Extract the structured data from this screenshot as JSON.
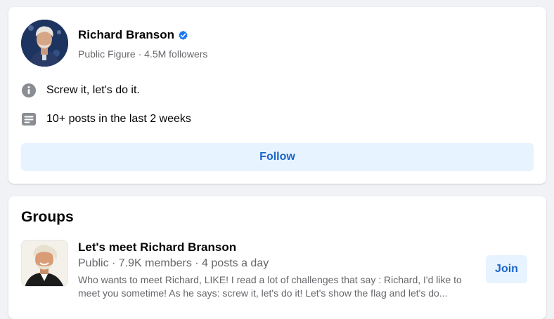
{
  "profile": {
    "name": "Richard Branson",
    "subtitle": "Public Figure · 4.5M followers",
    "verified": true,
    "info": [
      {
        "icon": "info-icon",
        "text": "Screw it, let's do it."
      },
      {
        "icon": "posts-icon",
        "text": "10+ posts in the last 2 weeks"
      }
    ],
    "follow_label": "Follow"
  },
  "groups": {
    "title": "Groups",
    "items": [
      {
        "name": "Let's meet Richard Branson",
        "meta": "Public · 7.9K members · 4 posts a day",
        "description": "Who wants to meet Richard, LIKE! I read a lot of challenges that say : Richard, I'd like to meet you sometime! As he says: screw it, let's do it! Let's show the flag and let's do...",
        "join_label": "Join"
      }
    ]
  },
  "colors": {
    "accent": "#1b64c7",
    "button_bg": "#e7f3ff",
    "verified": "#1877f2",
    "secondary_text": "#65676b",
    "page_bg": "#f0f2f5"
  }
}
